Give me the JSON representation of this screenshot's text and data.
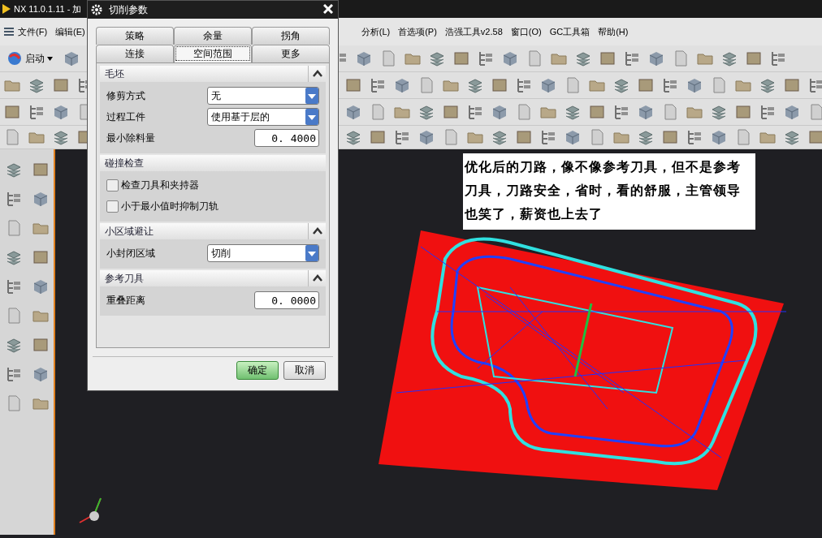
{
  "app": {
    "title": "NX 11.0.1.11 - 加",
    "start_button": "启动",
    "menu": [
      {
        "label": "文件(F)"
      },
      {
        "label": "编辑(E)"
      },
      {
        "label": "分析(L)"
      },
      {
        "label": "首选项(P)"
      },
      {
        "label": "浩强工具v2.58"
      },
      {
        "label": "窗口(O)"
      },
      {
        "label": "GC工具箱"
      },
      {
        "label": "帮助(H)"
      }
    ]
  },
  "viewport": {
    "note": "优化后的刀路，像不像参考刀具，但不是参考刀具，刀路安全，省时，看的舒服，主管领导也笑了，薪资也上去了"
  },
  "dialog": {
    "title": "切削参数",
    "tabs": [
      [
        {
          "label": "策略",
          "selected": false
        },
        {
          "label": "余量",
          "selected": false
        },
        {
          "label": "拐角",
          "selected": false
        }
      ],
      [
        {
          "label": "连接",
          "selected": false
        },
        {
          "label": "空间范围",
          "selected": true
        },
        {
          "label": "更多",
          "selected": false
        }
      ]
    ],
    "sections": [
      {
        "title": "毛坯",
        "expanded": true,
        "rows": [
          {
            "kind": "dropdown",
            "label": "修剪方式",
            "value": "无"
          },
          {
            "kind": "dropdown",
            "label": "过程工件",
            "value": "使用基于层的"
          },
          {
            "kind": "number",
            "label": "最小除料量",
            "value": "0. 4000"
          }
        ]
      },
      {
        "title": "碰撞检查",
        "rows": [
          {
            "kind": "checkbox",
            "label": "检查刀具和夹持器",
            "checked": false
          },
          {
            "kind": "checkbox",
            "label": "小于最小值时抑制刀轨",
            "checked": false
          }
        ]
      },
      {
        "title": "小区域避让",
        "expanded": true,
        "rows": [
          {
            "kind": "dropdown",
            "label": "小封闭区域",
            "value": "切削"
          }
        ]
      },
      {
        "title": "参考刀具",
        "expanded": true,
        "rows": [
          {
            "kind": "number",
            "label": "重叠距离",
            "value": "0. 0000"
          }
        ]
      }
    ],
    "buttons": [
      {
        "label": "确定",
        "kind": "primary"
      },
      {
        "label": "取消",
        "kind": "normal"
      }
    ]
  }
}
